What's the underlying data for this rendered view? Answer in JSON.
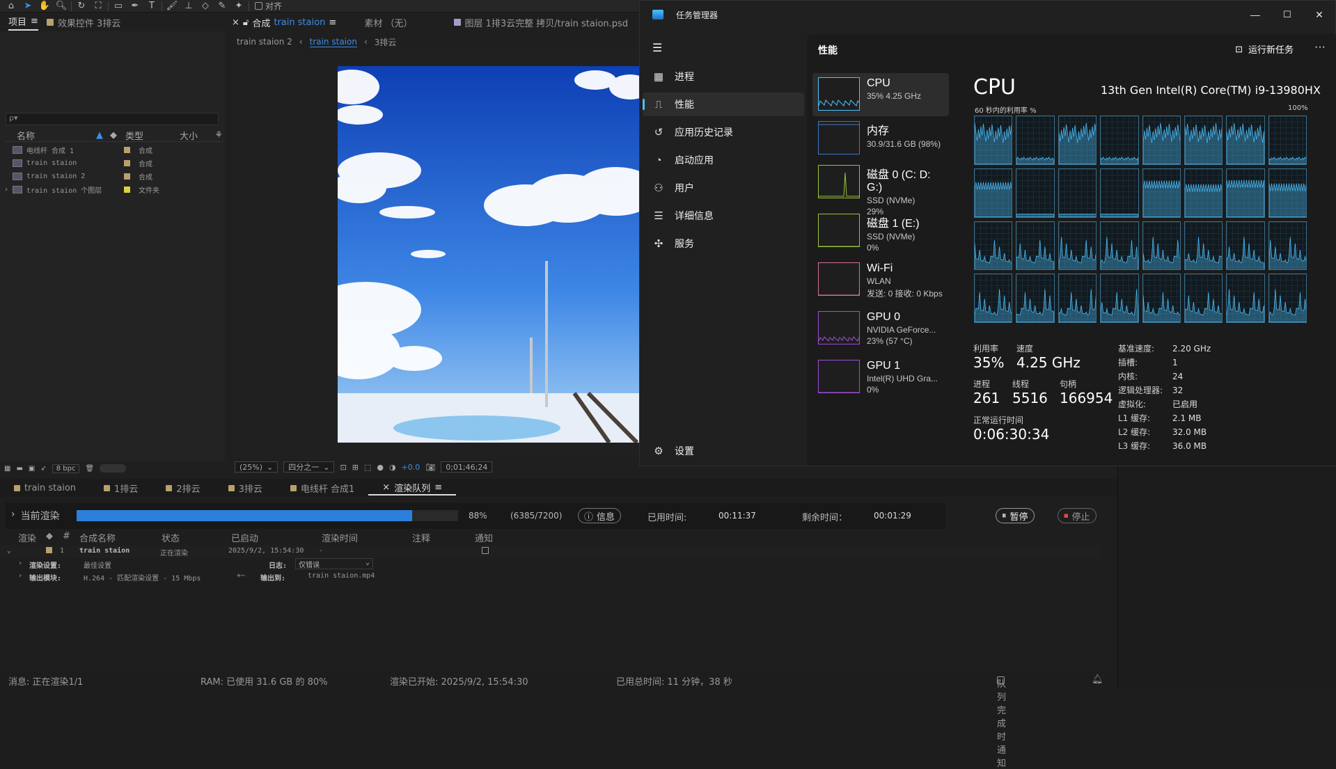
{
  "ae": {
    "toolbar": {
      "align_label": "对齐"
    },
    "project_tabs": {
      "project": "项目",
      "effects": "效果控件 3排云"
    },
    "project_search": {
      "placeholder": "ρ▾"
    },
    "project_columns": {
      "name": "名称",
      "type": "类型",
      "size": "大小"
    },
    "project_items": [
      {
        "name": "电线杆 合成 1",
        "type": "合成",
        "color": "#b9a06c"
      },
      {
        "name": "train staion",
        "type": "合成",
        "color": "#b9a06c"
      },
      {
        "name": "train staion 2",
        "type": "合成",
        "color": "#b9a06c"
      },
      {
        "name": "train staion 个图层",
        "type": "文件夹",
        "color": "#e0cf3a"
      }
    ],
    "project_footer": {
      "bpc": "8 bpc"
    },
    "comp_tabs": {
      "comp_prefix": "合成",
      "comp_name": "train staion",
      "footage": "素材 （无）",
      "layer": "图层 1排3云完整 拷贝/train staion.psd"
    },
    "breadcrumb": [
      "train staion 2",
      "train staion",
      "3排云"
    ],
    "viewer_footer": {
      "zoom": "(25%)",
      "resolution": "四分之一",
      "exposure": "+0.0",
      "timecode": "0;01;46;24"
    },
    "bottom_tabs": [
      "train staion",
      "1排云",
      "2排云",
      "3排云",
      "电线杆 合成1",
      "渲染队列"
    ],
    "render": {
      "current_label": "当前渲染",
      "progress": 0.88,
      "percent": "88%",
      "frames": "(6385/7200)",
      "info_button": "信息",
      "elapsed_label": "已用时间:",
      "elapsed": "00:11:37",
      "remaining_label": "剩余时间：",
      "remaining": "00:01:29",
      "pause_button": "暂停",
      "stop_button": "停止"
    },
    "queue_columns": {
      "render": "渲染",
      "num": "#",
      "comp": "合成名称",
      "status": "状态",
      "started": "已启动",
      "render_time": "渲染时间",
      "comment": "注释",
      "notify": "通知"
    },
    "queue_item": {
      "num": "1",
      "comp": "train staion",
      "status": "正在渲染",
      "started": "2025/9/2, 15:54:30",
      "render_time": "-"
    },
    "render_settings": {
      "label": "渲染设置:",
      "value": "最佳设置",
      "log_label": "日志:",
      "log_value": "仅错误"
    },
    "output_module": {
      "label": "输出模块:",
      "value": "H.264 - 匹配渲染设置 - 15 Mbps",
      "output_label": "输出到:",
      "output_value": "train staion.mp4"
    },
    "status": {
      "message": "消息: 正在渲染1/1",
      "ram": "RAM: 已使用 31.6 GB 的 80%",
      "started": "渲染已开始: 2025/9/2, 15:54:30",
      "total": "已用总时间: 11 分钟，38 秒",
      "notify": "队列完成时通知"
    }
  },
  "tm": {
    "title": "任务管理器",
    "nav": [
      {
        "label": "进程",
        "icon": "grid-icon"
      },
      {
        "label": "性能",
        "icon": "pulse-icon"
      },
      {
        "label": "应用历史记录",
        "icon": "history-icon"
      },
      {
        "label": "启动应用",
        "icon": "speedometer-icon"
      },
      {
        "label": "用户",
        "icon": "users-icon"
      },
      {
        "label": "详细信息",
        "icon": "list-icon"
      },
      {
        "label": "服务",
        "icon": "puzzle-icon"
      }
    ],
    "settings": "设置",
    "header": "性能",
    "new_task": "运行新任务",
    "resources": [
      {
        "name": "CPU",
        "line1": "35% 4.25 GHz",
        "line2": "",
        "color": "#4cc2ff"
      },
      {
        "name": "内存",
        "line1": "30.9/31.6 GB (98%)",
        "line2": "",
        "color": "#3e78c6"
      },
      {
        "name": "磁盘 0 (C: D: G:)",
        "line1": "SSD (NVMe)",
        "line2": "29%",
        "color": "#9ac23c"
      },
      {
        "name": "磁盘 1 (E:)",
        "line1": "SSD (NVMe)",
        "line2": "0%",
        "color": "#9ac23c"
      },
      {
        "name": "Wi-Fi",
        "line1": "WLAN",
        "line2": "发送: 0 接收: 0 Kbps",
        "color": "#d76f9f"
      },
      {
        "name": "GPU 0",
        "line1": "NVIDIA GeForce...",
        "line2": "23% (57 °C)",
        "color": "#a24ed8"
      },
      {
        "name": "GPU 1",
        "line1": "Intel(R) UHD Gra...",
        "line2": "0%",
        "color": "#a24ed8"
      }
    ],
    "cpu": {
      "title": "CPU",
      "model": "13th Gen Intel(R) Core(TM) i9-13980HX",
      "graph_label": "60 秒内的利用率 %",
      "graph_max": "100%",
      "utilization_label": "利用率",
      "utilization": "35%",
      "speed_label": "速度",
      "speed": "4.25 GHz",
      "processes_label": "进程",
      "processes": "261",
      "threads_label": "线程",
      "threads": "5516",
      "handles_label": "句柄",
      "handles": "166954",
      "uptime_label": "正常运行时间",
      "uptime": "0:06:30:34",
      "specs": [
        {
          "k": "基准速度:",
          "v": "2.20 GHz"
        },
        {
          "k": "插槽:",
          "v": "1"
        },
        {
          "k": "内核:",
          "v": "24"
        },
        {
          "k": "逻辑处理器:",
          "v": "32"
        },
        {
          "k": "虚拟化:",
          "v": "已启用"
        },
        {
          "k": "L1 缓存:",
          "v": "2.1 MB"
        },
        {
          "k": "L2 缓存:",
          "v": "32.0 MB"
        },
        {
          "k": "L3 缓存:",
          "v": "36.0 MB"
        }
      ]
    }
  }
}
